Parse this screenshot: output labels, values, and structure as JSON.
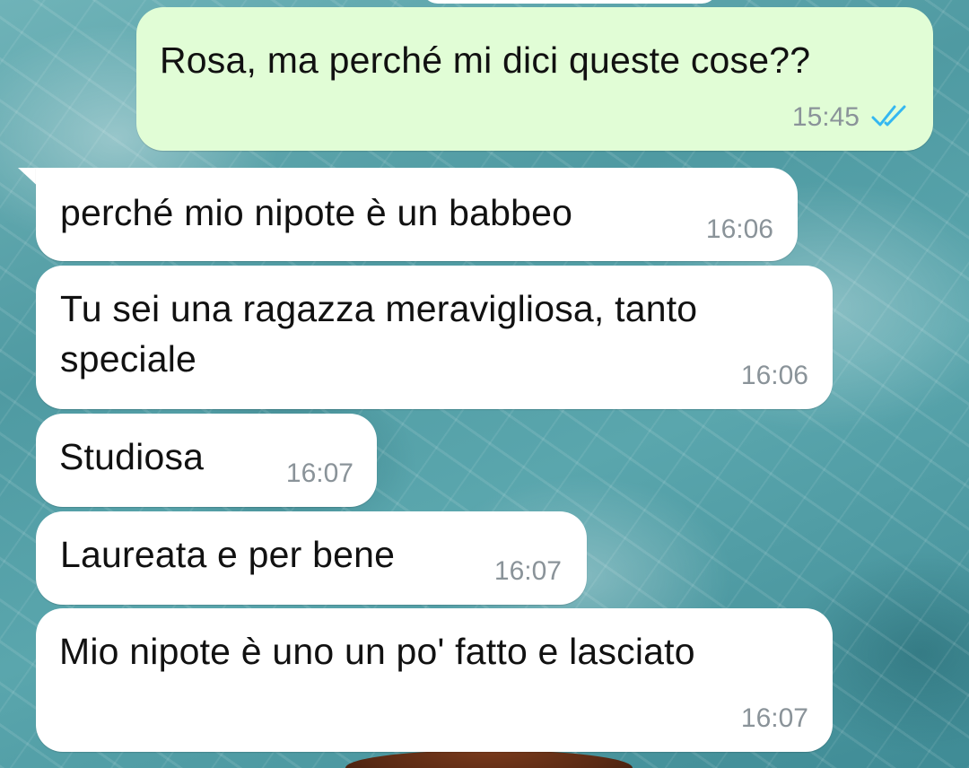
{
  "chat": {
    "messages": [
      {
        "direction": "outgoing",
        "text": "Rosa, ma perché mi dici queste cose??",
        "time": "15:45",
        "status": "read"
      },
      {
        "direction": "incoming",
        "text": "perché mio nipote è un babbeo",
        "time": "16:06"
      },
      {
        "direction": "incoming",
        "text": "Tu sei una ragazza meravigliosa, tanto\nspeciale",
        "time": "16:06"
      },
      {
        "direction": "incoming",
        "text": "Studiosa",
        "time": "16:07"
      },
      {
        "direction": "incoming",
        "text": "Laureata e per bene",
        "time": "16:07"
      },
      {
        "direction": "incoming",
        "text": "Mio nipote è uno un po' fatto e lasciato",
        "time": "16:07"
      }
    ]
  },
  "colors": {
    "outgoing_bubble": "#e1fdd6",
    "incoming_bubble": "#ffffff",
    "read_ticks": "#34b7f1",
    "timestamp": "#8a9399"
  },
  "icons": {
    "read_receipt": "double-check-icon"
  }
}
